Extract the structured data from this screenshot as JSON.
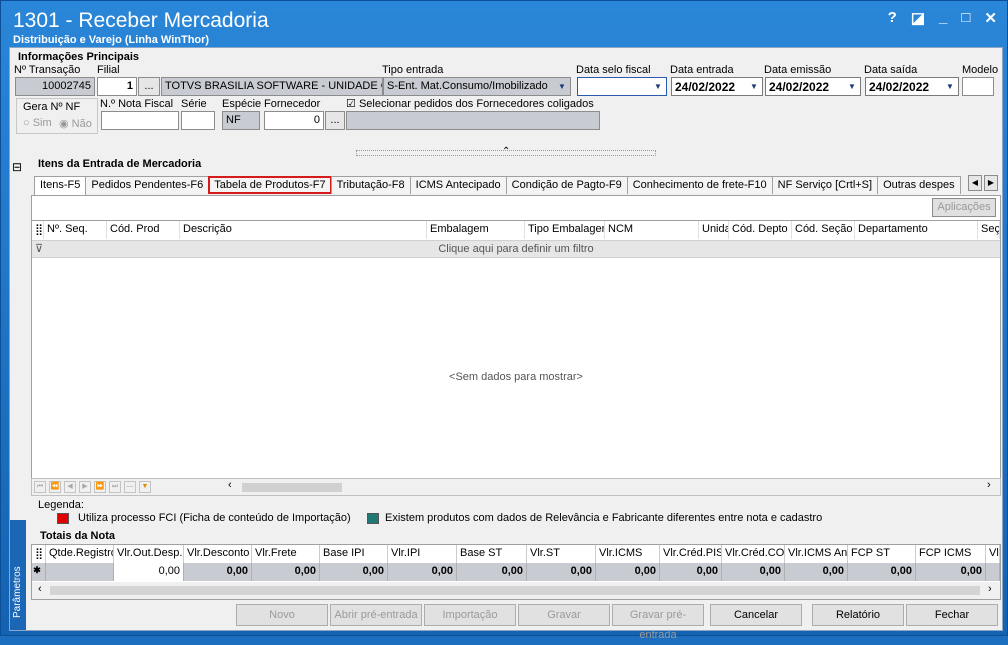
{
  "window": {
    "title": "1301 - Receber Mercadoria",
    "subtitle": "Distribuição e Varejo (Linha WinThor)",
    "help": "?",
    "restore": "◪",
    "minimize": "_",
    "maximize": "□",
    "close": "✕"
  },
  "main_info": {
    "section_title": "Informações Principais",
    "lbl_transacao": "Nº Transação",
    "transacao": "10002745",
    "lbl_filial": "Filial",
    "filial": "1",
    "filial_btn": "...",
    "filial_nome": "TOTVS BRASILIA SOFTWARE - UNIDADE GOIÂ",
    "lbl_tipo": "Tipo entrada",
    "tipo": "S-Ent. Mat.Consumo/Imobilizado",
    "lbl_selo": "Data selo fiscal",
    "selo": "",
    "lbl_entrada": "Data entrada",
    "entrada": "24/02/2022",
    "lbl_emissao": "Data emissão",
    "emissao": "24/02/2022",
    "lbl_saida": "Data saída",
    "saida": "24/02/2022",
    "lbl_modelo": "Modelo",
    "modelo": "",
    "lbl_gera": "Gera Nº NF",
    "sim": "Sim",
    "nao": "Não",
    "lbl_nf": "N.º Nota Fiscal",
    "nf": "",
    "lbl_serie": "Série",
    "serie": "",
    "lbl_especie": "Espécie",
    "especie": "NF",
    "lbl_fornecedor": "Fornecedor",
    "fornecedor": "0",
    "forn_btn": "...",
    "forn_nome": "",
    "chk_coligados": "Selecionar pedidos dos Fornecedores coligados"
  },
  "items": {
    "section_title": "Itens da Entrada de Mercadoria",
    "tabs": [
      "Itens-F5",
      "Pedidos Pendentes-F6",
      "Tabela de Produtos-F7",
      "Tributação-F8",
      "ICMS Antecipado",
      "Condição de Pagto-F9",
      "Conhecimento de frete-F10",
      "NF Serviço [Crtl+S]",
      "Outras despes"
    ],
    "aplicacoes": "Aplicações",
    "columns": [
      "Nº. Seq.",
      "Cód. Prod",
      "Descrição",
      "Embalagem",
      "Tipo Embalagem",
      "NCM",
      "Unida",
      "Cód. Depto",
      "Cód. Seção",
      "Departamento",
      "Seç"
    ],
    "filter_text": "Clique aqui para definir um filtro",
    "no_data": "<Sem dados para mostrar>"
  },
  "legend": {
    "title": "Legenda:",
    "item1": "Utiliza processo FCI (Ficha de conteúdo de Importação)",
    "item1_color": "#e00000",
    "item2": "Existem produtos com dados de Relevância e Fabricante diferentes entre nota e cadastro",
    "item2_color": "#1e7a73"
  },
  "totals": {
    "section_title": "Totais da Nota",
    "columns": [
      "Qtde.Registro",
      "Vlr.Out.Desp.",
      "Vlr.Desconto",
      "Vlr.Frete",
      "Base IPI",
      "Vlr.IPI",
      "Base ST",
      "Vlr.ST",
      "Vlr.ICMS",
      "Vlr.Créd.PIS",
      "Vlr.Créd.CO",
      "Vlr.ICMS An",
      "FCP ST",
      "FCP ICMS",
      "Vl"
    ],
    "values": [
      "",
      "0,00",
      "0,00",
      "0,00",
      "0,00",
      "0,00",
      "0,00",
      "0,00",
      "0,00",
      "0,00",
      "0,00",
      "0,00",
      "0,00",
      "0,00",
      ""
    ]
  },
  "side_label": "Parâmetros",
  "footer": {
    "novo": "Novo",
    "abrir": "Abrir pré-entrada",
    "importacao": "Importação",
    "gravar": "Gravar",
    "gravar_pre": "Gravar pré-entrada",
    "cancelar": "Cancelar",
    "relatorio": "Relatório",
    "fechar": "Fechar"
  }
}
